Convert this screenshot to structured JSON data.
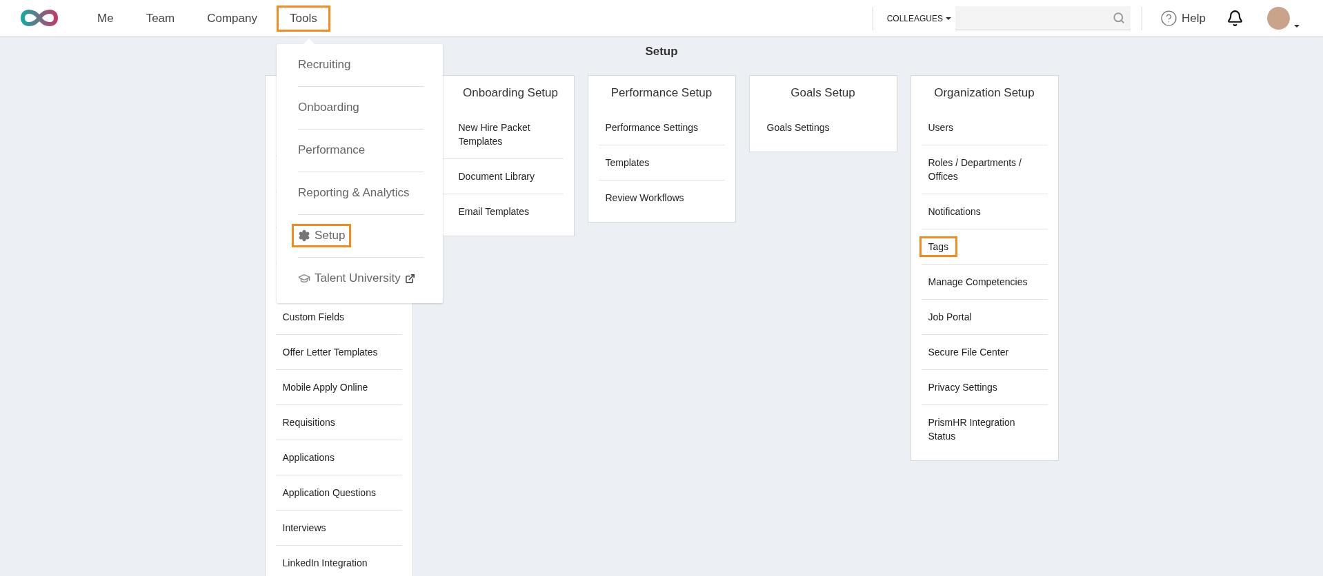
{
  "nav": {
    "items": [
      {
        "label": "Me",
        "highlighted": false
      },
      {
        "label": "Team",
        "highlighted": false
      },
      {
        "label": "Company",
        "highlighted": false
      },
      {
        "label": "Tools",
        "highlighted": true
      }
    ]
  },
  "tools_menu": {
    "items": [
      {
        "label": "Recruiting",
        "kind": "plain",
        "highlighted": false
      },
      {
        "label": "Onboarding",
        "kind": "plain",
        "highlighted": false
      },
      {
        "label": "Performance",
        "kind": "plain",
        "highlighted": false
      },
      {
        "label": "Reporting & Analytics",
        "kind": "plain",
        "highlighted": false
      },
      {
        "label": "Setup",
        "kind": "settings",
        "highlighted": true
      },
      {
        "label": "Talent University",
        "kind": "external",
        "highlighted": false
      }
    ]
  },
  "colleagues": {
    "label": "COLLEAGUES"
  },
  "help": {
    "label": "Help"
  },
  "page_title": "Setup",
  "cards": [
    {
      "kind": "covered",
      "items": [
        {
          "label": "Custom Fields",
          "highlighted": false
        },
        {
          "label": "Offer Letter Templates",
          "highlighted": false
        },
        {
          "label": "Mobile Apply Online",
          "highlighted": false
        },
        {
          "label": "Requisitions",
          "highlighted": false
        },
        {
          "label": "Applications",
          "highlighted": false
        },
        {
          "label": "Application Questions",
          "highlighted": false
        },
        {
          "label": "Interviews",
          "highlighted": false
        },
        {
          "label": "LinkedIn Integration",
          "highlighted": false
        }
      ]
    },
    {
      "kind": "overlapped",
      "title": "Onboarding Setup",
      "items": [
        {
          "label": "New Hire Packet Templates",
          "highlighted": false
        },
        {
          "label": "Document Library",
          "highlighted": false
        },
        {
          "label": "Email Templates",
          "highlighted": false
        }
      ]
    },
    {
      "kind": "full",
      "title": "Performance Setup",
      "items": [
        {
          "label": "Performance Settings",
          "highlighted": false
        },
        {
          "label": "Templates",
          "highlighted": false
        },
        {
          "label": "Review Workflows",
          "highlighted": false
        }
      ]
    },
    {
      "kind": "full",
      "title": "Goals Setup",
      "items": [
        {
          "label": "Goals Settings",
          "highlighted": false
        }
      ]
    },
    {
      "kind": "full",
      "title": "Organization Setup",
      "items": [
        {
          "label": "Users",
          "highlighted": false
        },
        {
          "label": "Roles / Departments / Offices",
          "highlighted": false
        },
        {
          "label": "Notifications",
          "highlighted": false
        },
        {
          "label": "Tags",
          "highlighted": true
        },
        {
          "label": "Manage Competencies",
          "highlighted": false
        },
        {
          "label": "Job Portal",
          "highlighted": false
        },
        {
          "label": "Secure File Center",
          "highlighted": false
        },
        {
          "label": "Privacy Settings",
          "highlighted": false
        },
        {
          "label": "PrismHR Integration Status",
          "highlighted": false
        }
      ]
    }
  ]
}
